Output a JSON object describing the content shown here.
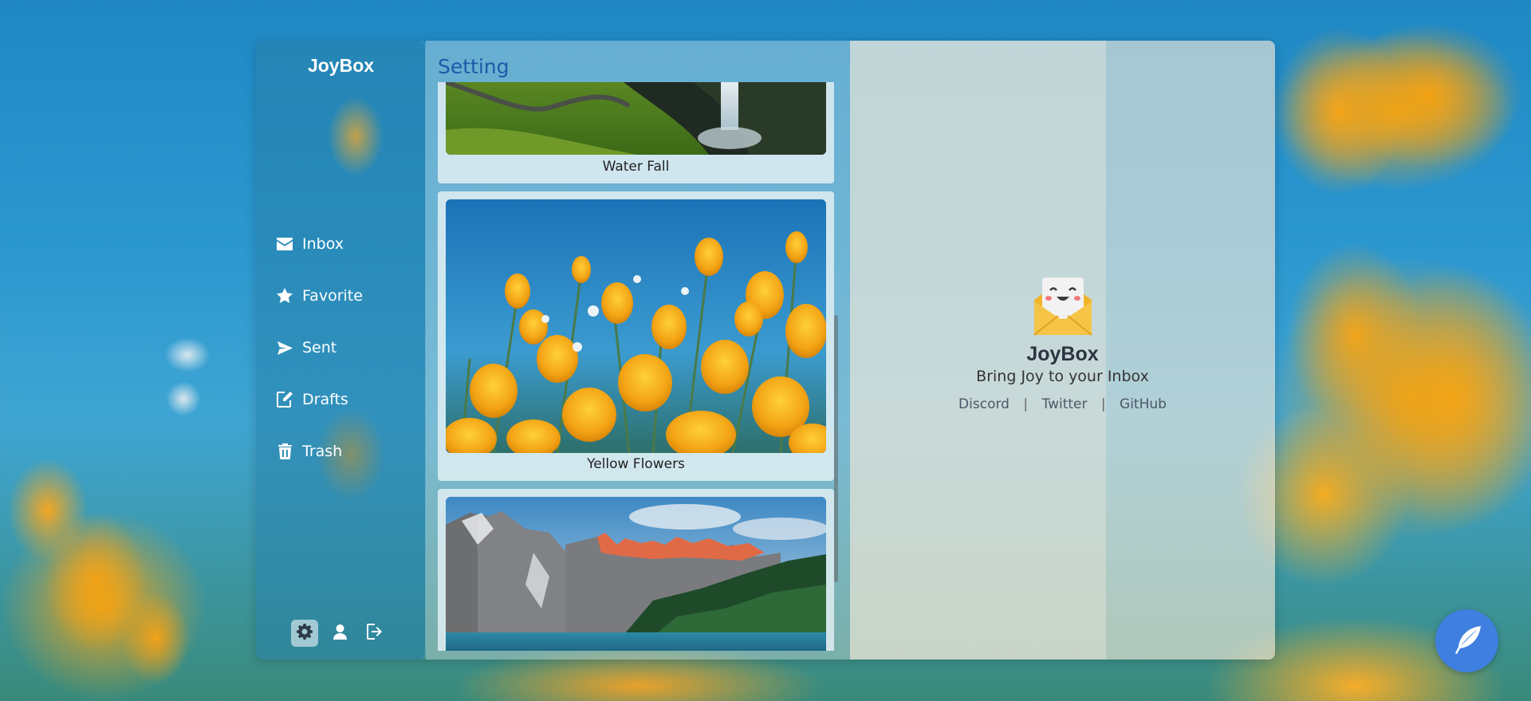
{
  "app": {
    "title": "JoyBox"
  },
  "sidebar": {
    "items": [
      {
        "label": "Inbox",
        "icon": "envelope-icon"
      },
      {
        "label": "Favorite",
        "icon": "star-icon"
      },
      {
        "label": "Sent",
        "icon": "send-icon"
      },
      {
        "label": "Drafts",
        "icon": "edit-icon"
      },
      {
        "label": "Trash",
        "icon": "trash-icon"
      }
    ],
    "bottom_icons": [
      "gear-icon",
      "user-icon",
      "logout-icon"
    ]
  },
  "settings": {
    "heading": "Setting",
    "wallpapers": [
      {
        "caption": "Water Fall"
      },
      {
        "caption": "Yellow Flowers"
      },
      {
        "caption": ""
      }
    ]
  },
  "preview": {
    "name": "JoyBox",
    "tagline": "Bring Joy to your Inbox",
    "links": [
      "Discord",
      "Twitter",
      "GitHub"
    ],
    "separator": "|"
  },
  "compose": {
    "icon": "feather-icon"
  },
  "colors": {
    "accent": "#3f7fe0",
    "heading": "#1e5aa8",
    "logo_yellow": "#f5c242"
  }
}
